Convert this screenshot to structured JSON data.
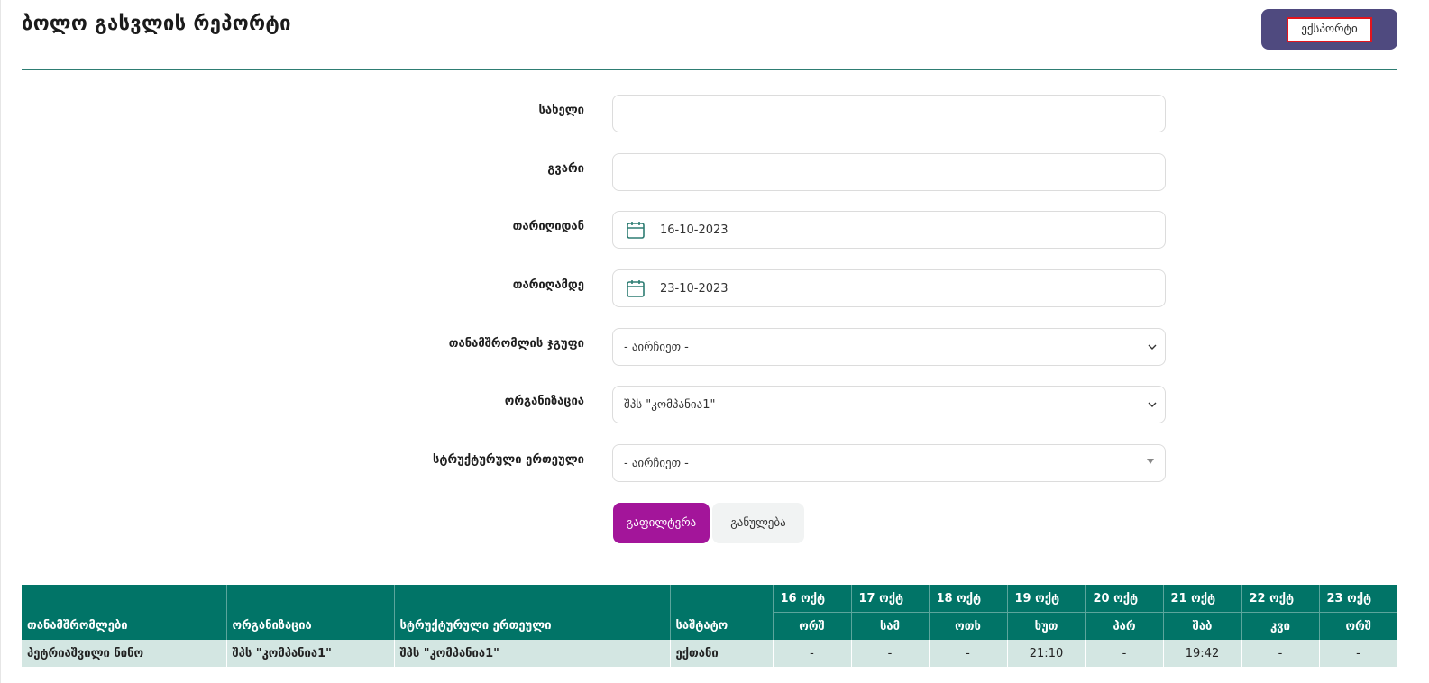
{
  "page": {
    "title": "ბოლო გასვლის რეპორტი"
  },
  "toolbar": {
    "export_label": "ექსპორტი"
  },
  "form": {
    "first_name": {
      "label": "სახელი",
      "value": ""
    },
    "last_name": {
      "label": "გვარი",
      "value": ""
    },
    "date_from": {
      "label": "თარიღიდან",
      "value": "16-10-2023"
    },
    "date_to": {
      "label": "თარიღამდე",
      "value": "23-10-2023"
    },
    "employee_group": {
      "label": "თანამშრომლის ჯგუფი",
      "value": "- აირჩიეთ -"
    },
    "organization": {
      "label": "ორგანიზაცია",
      "value": "შპს \"კომპანია1\""
    },
    "structural_unit": {
      "label": "სტრუქტურული ერთეული",
      "value": "- აირჩიეთ -"
    }
  },
  "actions": {
    "filter_label": "გაფილტვრა",
    "reset_label": "განულება"
  },
  "table": {
    "headers": {
      "employees": "თანამშრომლები",
      "organization": "ორგანიზაცია",
      "unit": "სტრუქტურული ერთეული",
      "staff": "საშტატო"
    },
    "dates": [
      {
        "date": "16 ოქტ",
        "day": "ორშ"
      },
      {
        "date": "17 ოქტ",
        "day": "სამ"
      },
      {
        "date": "18 ოქტ",
        "day": "ოთხ"
      },
      {
        "date": "19 ოქტ",
        "day": "ხუთ"
      },
      {
        "date": "20 ოქტ",
        "day": "პარ"
      },
      {
        "date": "21 ოქტ",
        "day": "შაბ"
      },
      {
        "date": "22 ოქტ",
        "day": "კვი"
      },
      {
        "date": "23 ოქტ",
        "day": "ორშ"
      }
    ],
    "rows": [
      {
        "employee": "პეტრიაშვილი ნინო",
        "organization": "შპს \"კომპანია1\"",
        "unit": "შპს \"კომპანია1\"",
        "staff": "ექთანი",
        "times": [
          "-",
          "-",
          "-",
          "21:10",
          "-",
          "19:42",
          "-",
          "-"
        ]
      }
    ]
  },
  "colors": {
    "accent": "#017467",
    "filter": "#a3159a",
    "export": "#4f4a7f"
  }
}
